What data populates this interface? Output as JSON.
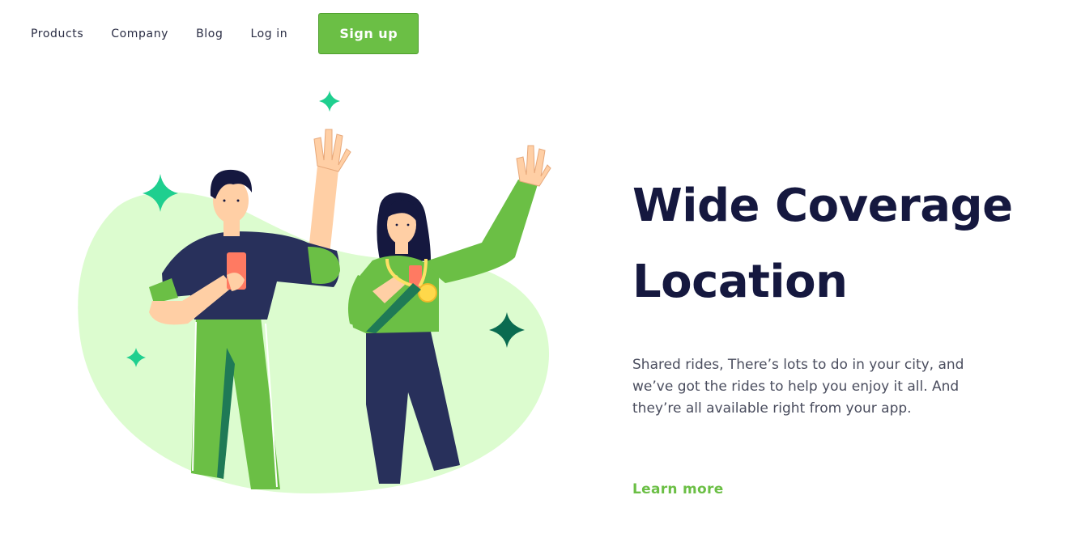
{
  "nav": {
    "items": [
      {
        "label": "Products"
      },
      {
        "label": "Company"
      },
      {
        "label": "Blog"
      },
      {
        "label": "Log in"
      }
    ],
    "signup_label": "Sign up"
  },
  "hero": {
    "title_line1": "Wide Coverage",
    "title_line2": "Location",
    "description_line1": "Shared rides, There’s lots to do in your city, and",
    "description_line2": "we’ve got the rides to help you enjoy it all. And",
    "description_line3": "they’re all available right from your app.",
    "link_label": "Learn more"
  },
  "colors": {
    "accent_green": "#6bbf45",
    "title_navy": "#15183f",
    "blob_mint": "#dcfccf",
    "sparkle_teal": "#1fcf8f",
    "sparkle_dark": "#0a6b50"
  },
  "illustration": {
    "icons": [
      "sparkle-icon",
      "man-waving-figure",
      "woman-waving-figure",
      "phone-icon",
      "medal-icon"
    ]
  }
}
